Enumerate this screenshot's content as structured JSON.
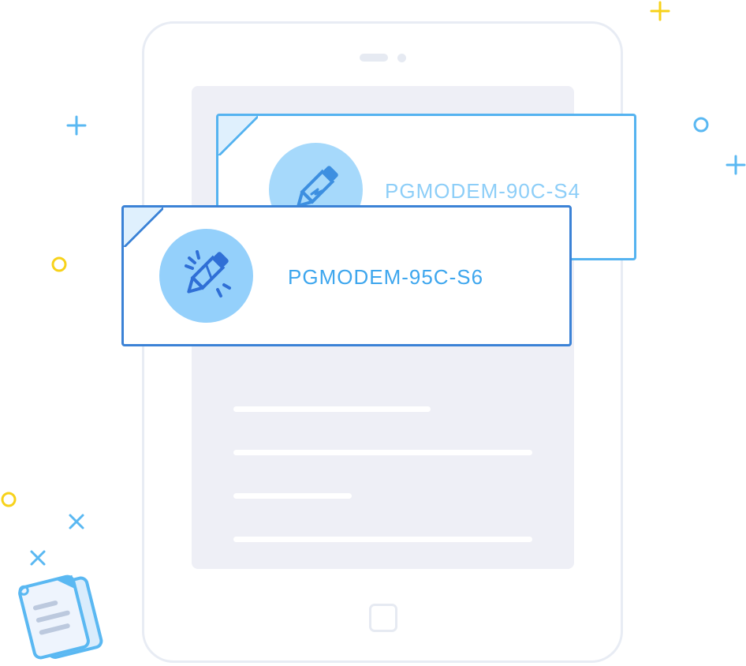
{
  "cards": [
    {
      "label": "PGMODEM-90C-S4",
      "icon": "pencil-icon"
    },
    {
      "label": "PGMODEM-95C-S6",
      "icon": "broken-pencil-icon"
    }
  ],
  "colors": {
    "card_back_border": "#55b3f0",
    "card_front_border": "#3b82d6",
    "tablet_border": "#e8ecf4",
    "screen_bg": "#eeeff6",
    "decoration_blue": "#5ab8f2",
    "decoration_yellow": "#f7d21a"
  }
}
